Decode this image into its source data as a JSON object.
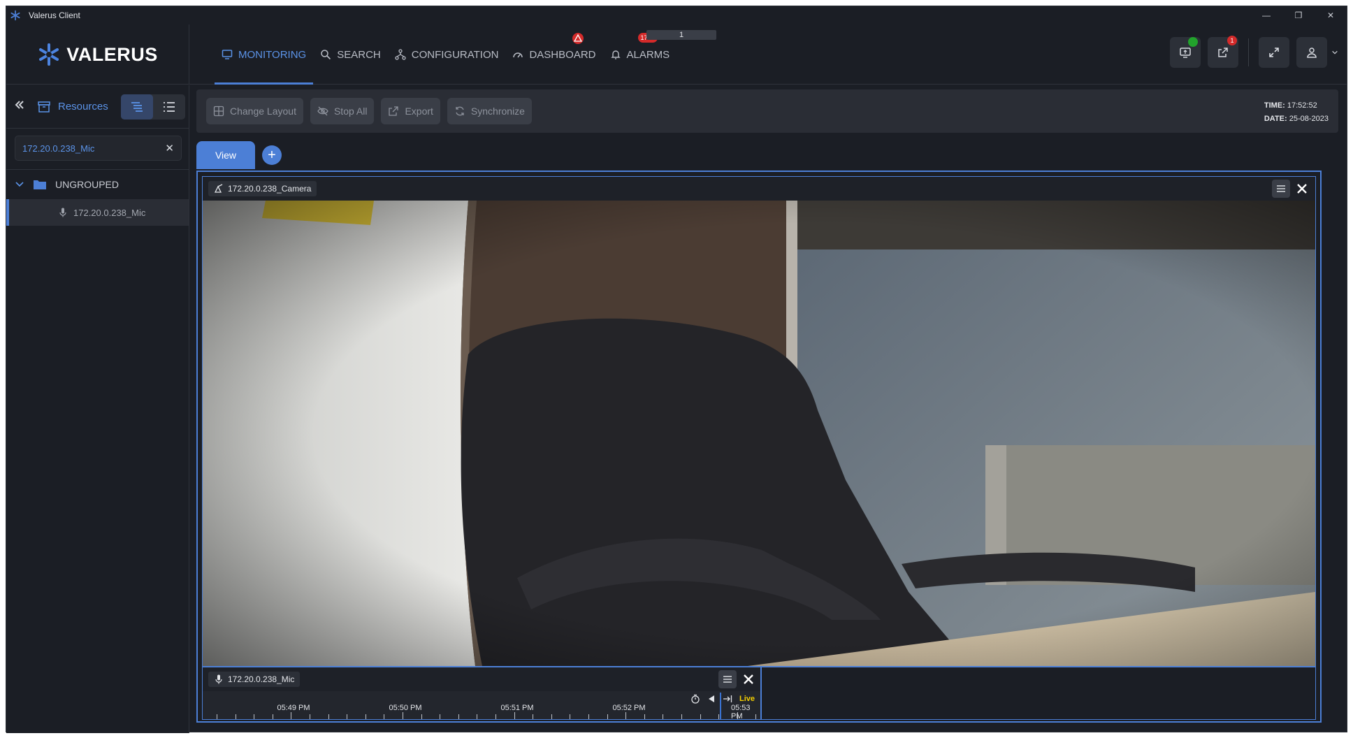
{
  "window": {
    "title": "Valerus Client",
    "controls": {
      "minimize": "—",
      "restore": "❐",
      "close": "✕"
    }
  },
  "header": {
    "logo_text": "VALERUS",
    "nav": [
      {
        "label": "MONITORING",
        "icon": "monitor-icon",
        "active": true
      },
      {
        "label": "SEARCH",
        "icon": "search-icon",
        "active": false
      },
      {
        "label": "CONFIGURATION",
        "icon": "network-icon",
        "active": false
      },
      {
        "label": "DASHBOARD",
        "icon": "gauge-icon",
        "active": false,
        "badge_icon": "alert-icon"
      },
      {
        "label": "ALARMS",
        "icon": "bell-icon",
        "active": false,
        "badge": "1724"
      }
    ],
    "page_indicator": "1",
    "notifications_count": "1",
    "connection_status_color": "#22a32c"
  },
  "sidebar": {
    "title": "Resources",
    "search": {
      "value": "172.20.0.238_Mic",
      "placeholder": ""
    },
    "tree": {
      "group_label": "UNGROUPED",
      "items": [
        {
          "label": "172.20.0.238_Mic",
          "icon": "microphone-icon"
        }
      ]
    }
  },
  "toolbar": {
    "buttons": [
      {
        "label": "Change Layout",
        "icon": "grid-icon"
      },
      {
        "label": "Stop All",
        "icon": "eye-off-icon"
      },
      {
        "label": "Export",
        "icon": "export-icon"
      },
      {
        "label": "Synchronize",
        "icon": "sync-icon"
      }
    ],
    "time_label": "TIME:",
    "time_value": "17:52:52",
    "date_label": "DATE:",
    "date_value": "25-08-2023"
  },
  "view_tabs": [
    {
      "label": "View"
    }
  ],
  "add_tab_label": "+",
  "tiles": {
    "camera": {
      "label": "172.20.0.238_Camera",
      "icon": "camera-icon"
    },
    "mic": {
      "label": "172.20.0.238_Mic",
      "icon": "microphone-icon",
      "live_label": "Live",
      "timeline_labels": [
        "05:49 PM",
        "05:50 PM",
        "05:51 PM",
        "05:52 PM",
        "05:53 PM"
      ]
    }
  },
  "colors": {
    "accent": "#4c7fd6",
    "badge": "#d42a2a",
    "live": "#f5d000"
  }
}
